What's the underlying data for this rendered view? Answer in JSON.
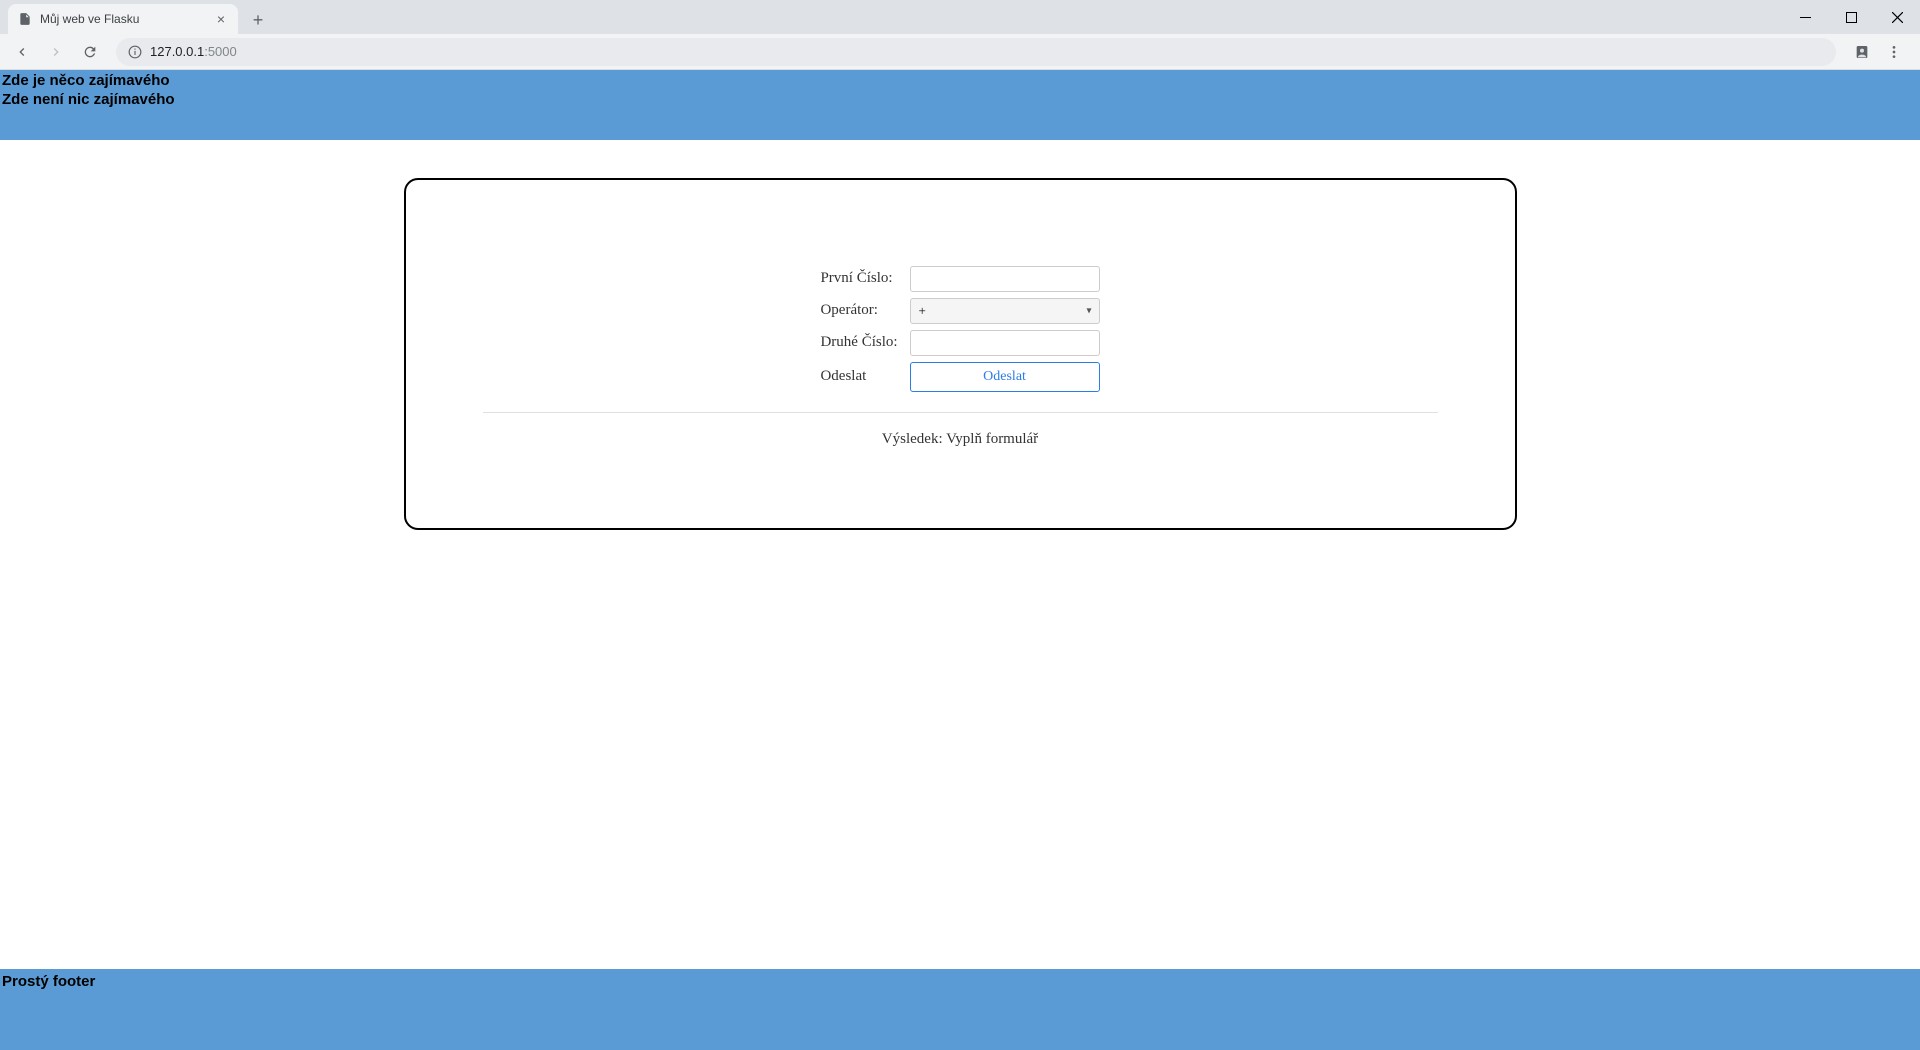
{
  "browser": {
    "tab_title": "Můj web ve Flasku",
    "url_host": "127.0.0.1",
    "url_port": ":5000"
  },
  "header": {
    "line1": "Zde je něco zajímavého",
    "line2": "Zde není nic zajímavého"
  },
  "form": {
    "first_number_label": "První Číslo:",
    "first_number_value": "",
    "operator_label": "Operátor:",
    "operator_value": "+",
    "second_number_label": "Druhé Číslo:",
    "second_number_value": "",
    "submit_row_label": "Odeslat",
    "submit_button_label": "Odeslat"
  },
  "result": {
    "prefix": "Výsledek: ",
    "value": "Vyplň formulář"
  },
  "footer": {
    "text": "Prostý footer"
  }
}
